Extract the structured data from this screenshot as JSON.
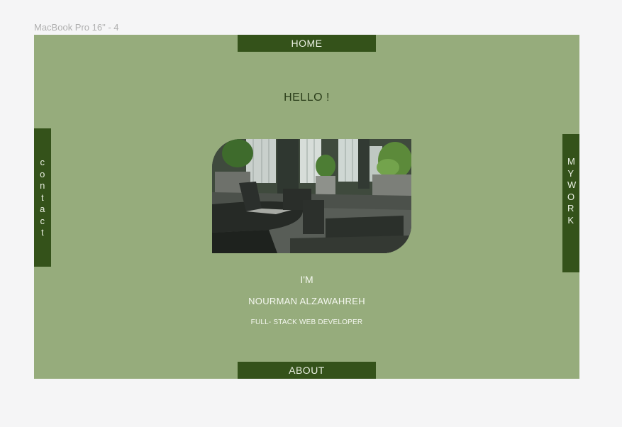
{
  "canvas": {
    "frame_label": "MacBook Pro 16\" - 4"
  },
  "nav": {
    "home": "HOME",
    "about": "ABOUT",
    "contact": "contact",
    "my_work": "MY WORK"
  },
  "hero": {
    "greeting": "HELLO !",
    "im": "I'M",
    "name": "NOURMAN ALZAWAHREH",
    "role": "FULL- STACK WEB DEVELOPER"
  },
  "colors": {
    "background": "#96ac7c",
    "nav_bar": "#34521a",
    "canvas": "#f5f5f6"
  }
}
